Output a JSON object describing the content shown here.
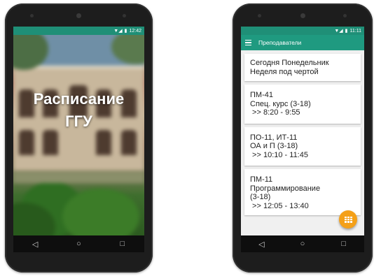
{
  "phone1": {
    "status": {
      "time": "12:42",
      "signal": "▼◢",
      "battery": "▮"
    },
    "splash_title_line1": "Расписание",
    "splash_title_line2": "ГГУ",
    "nav": {
      "back": "◁",
      "home": "○",
      "recent": "□"
    }
  },
  "phone2": {
    "status": {
      "time": "11:11",
      "signal": "▼◢",
      "battery": "▮"
    },
    "appbar_title": "Преподаватели",
    "cards": [
      {
        "lines": [
          "Сегодня Понедельник",
          "Неделя под чертой"
        ]
      },
      {
        "lines": [
          "ПМ-41",
          "Спец. курс (3-18)",
          " >> 8:20 - 9:55"
        ]
      },
      {
        "lines": [
          "ПО-11, ИТ-11",
          "ОА и П (3-18)",
          " >> 10:10 - 11:45"
        ]
      },
      {
        "lines": [
          "ПМ-11",
          "Программирование",
          "(3-18)",
          " >> 12:05 - 13:40"
        ]
      }
    ],
    "nav": {
      "back": "◁",
      "home": "○",
      "recent": "□"
    }
  },
  "colors": {
    "primary": "#1f9a80",
    "status": "#1f8f77",
    "fab": "#f4a018"
  }
}
